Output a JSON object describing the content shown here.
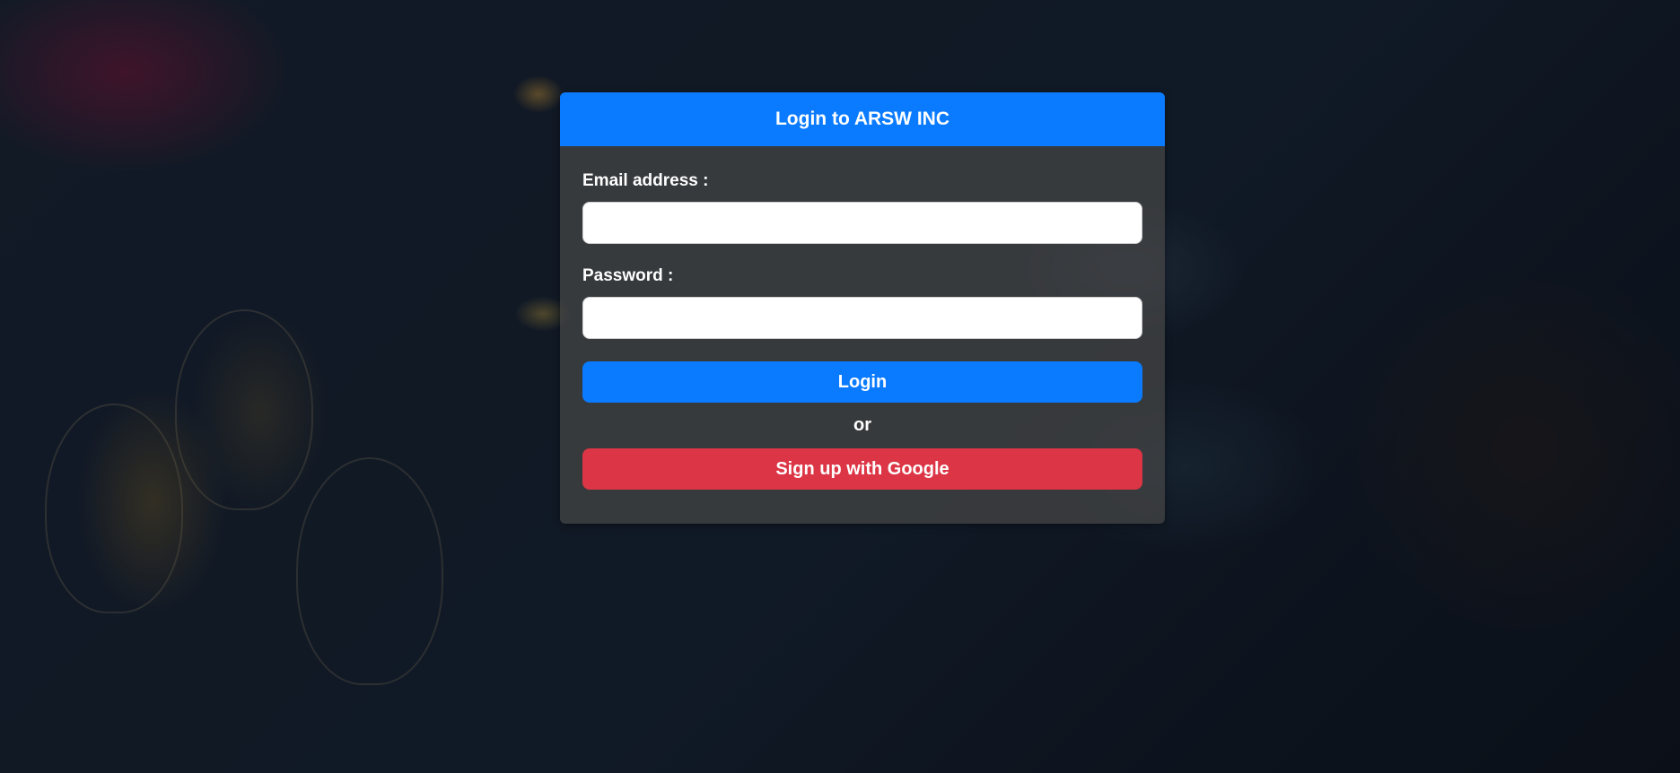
{
  "login_card": {
    "title": "Login to ARSW INC",
    "email_label": "Email address :",
    "email_value": "",
    "password_label": "Password :",
    "password_value": "",
    "login_button": "Login",
    "or_text": "or",
    "google_button": "Sign up with Google"
  },
  "colors": {
    "primary": "#0a7bff",
    "danger": "#dc3545",
    "card_background": "rgba(70,70,70,0.72)"
  }
}
